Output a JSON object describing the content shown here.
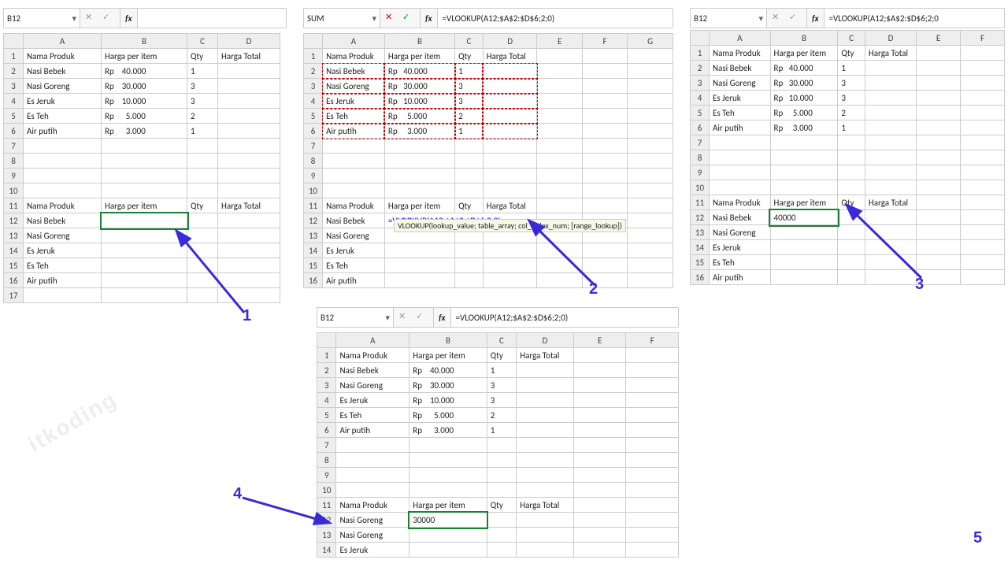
{
  "watermark": "itkoding",
  "headers": {
    "name": "Nama Produk",
    "price": "Harga per item",
    "qty": "Qty",
    "total": "Harga Total"
  },
  "products": [
    {
      "name": "Nasi Bebek",
      "cur": "Rp",
      "price": "40.000",
      "qty": "1"
    },
    {
      "name": "Nasi Goreng",
      "cur": "Rp",
      "price": "30.000",
      "qty": "3"
    },
    {
      "name": "Es Jeruk",
      "cur": "Rp",
      "price": "10.000",
      "qty": "3"
    },
    {
      "name": "Es Teh",
      "cur": "Rp",
      "price": "5.000",
      "qty": "2"
    },
    {
      "name": "Air putih",
      "cur": "Rp",
      "price": "3.000",
      "qty": "1"
    }
  ],
  "lookup": [
    "Nasi Bebek",
    "Nasi Goreng",
    "Es Jeruk",
    "Es Teh",
    "Air putih"
  ],
  "frag1": {
    "cell": "B12",
    "cols": [
      "A",
      "B",
      "C",
      "D"
    ],
    "callout": "1"
  },
  "frag2": {
    "cell": "SUM",
    "formula": "=VLOOKUP(A12;$A$2:$D$6;2;0)",
    "entered": "=VLOOKUP(A12;$A$2:$D$6;2;0)",
    "tip": "VLOOKUP(lookup_value; table_array; col_index_num; [range_lookup])",
    "cols": [
      "A",
      "B",
      "C",
      "D",
      "E",
      "F",
      "G"
    ],
    "callout": "2"
  },
  "frag3": {
    "cell": "B12",
    "formula": "=VLOOKUP(A12;$A$2:$D$6;2;0",
    "result": "40000",
    "cols": [
      "A",
      "B",
      "C",
      "D",
      "E",
      "F"
    ],
    "callout": "3"
  },
  "frag4": {
    "cell": "B12",
    "formula": "=VLOOKUP(A12;$A$2:$D$6;2;0)",
    "result": "30000",
    "lookup0": "Nasi Goreng",
    "cols": [
      "A",
      "B",
      "C",
      "D",
      "E",
      "F"
    ],
    "callout": "4"
  },
  "frag5": {
    "callout": "5"
  }
}
